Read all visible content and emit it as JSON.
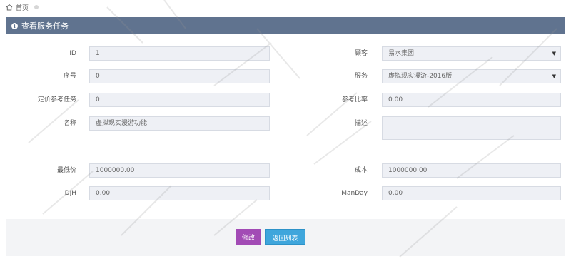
{
  "breadcrumb": {
    "home_label": "首页"
  },
  "panel": {
    "title": "查看服务任务"
  },
  "left_fields": [
    {
      "label": "ID",
      "value": "1"
    },
    {
      "label": "序号",
      "value": "0"
    },
    {
      "label": "定价参考任务",
      "value": "0"
    },
    {
      "label": "名称",
      "value": "虚拟现实漫游功能"
    },
    {
      "label": "最低价",
      "value": "1000000.00"
    },
    {
      "label": "DJH",
      "value": "0.00"
    }
  ],
  "right_fields": [
    {
      "label": "顾客",
      "value": "易水集团"
    },
    {
      "label": "服务",
      "value": "虚拟现实漫游-2016版"
    },
    {
      "label": "参考比率",
      "value": "0.00"
    },
    {
      "label": "描述",
      "value": ""
    },
    {
      "label": "成本",
      "value": "1000000.00"
    },
    {
      "label": "ManDay",
      "value": "0.00"
    }
  ],
  "buttons": {
    "edit_label": "修改",
    "back_label": "返回列表"
  },
  "colors": {
    "header": "#60738f",
    "edit_button": "#a24bb5",
    "back_button": "#3fa6dc"
  }
}
